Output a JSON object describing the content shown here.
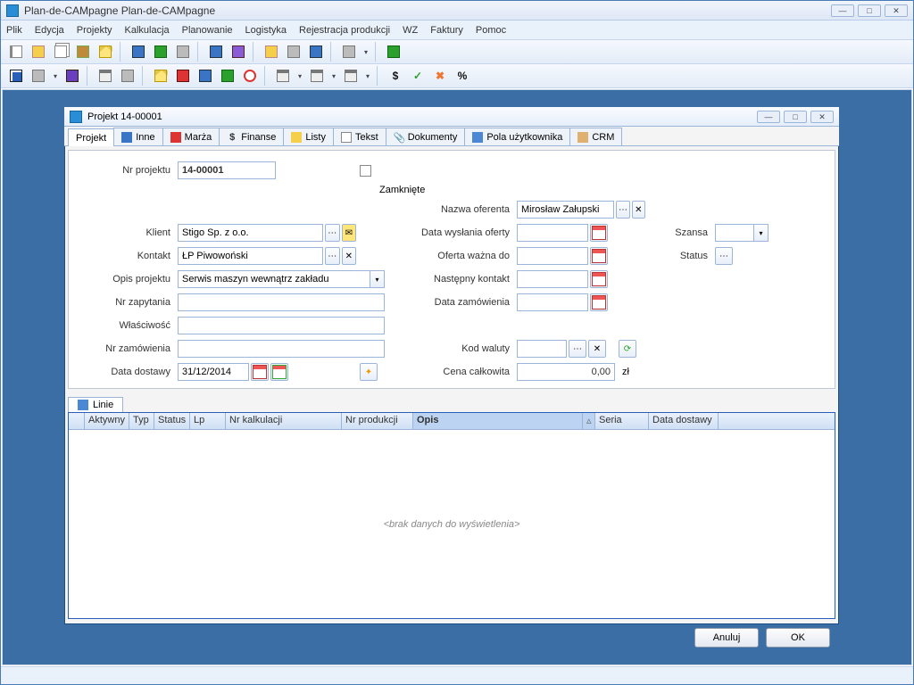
{
  "app": {
    "title": "Plan-de-CAMpagne   Plan-de-CAMpagne"
  },
  "menu": [
    "Plik",
    "Edycja",
    "Projekty",
    "Kalkulacja",
    "Planowanie",
    "Logistyka",
    "Rejestracja produkcji",
    "WZ",
    "Faktury",
    "Pomoc"
  ],
  "inner": {
    "title": "Projekt 14-00001",
    "tabs": [
      "Projekt",
      "Inne",
      "Marża",
      "Finanse",
      "Listy",
      "Tekst",
      "Dokumenty",
      "Pola użytkownika",
      "CRM"
    ],
    "labels": {
      "nr_projektu": "Nr projektu",
      "zamkniete": "Zamknięte",
      "nazwa_oferenta": "Nazwa oferenta",
      "klient": "Klient",
      "data_wyslania": "Data wysłania oferty",
      "szansa": "Szansa",
      "kontakt": "Kontakt",
      "oferta_wazna": "Oferta ważna do",
      "status": "Status",
      "opis_projektu": "Opis projektu",
      "nastepny_kontakt": "Następny kontakt",
      "nr_zapytania": "Nr zapytania",
      "data_zamowienia": "Data zamówienia",
      "wlasciowosc": "Właściwość",
      "nr_zamowienia": "Nr zamówienia",
      "kod_waluty": "Kod waluty",
      "data_dostawy": "Data dostawy",
      "cena_calkowita": "Cena całkowita",
      "zl": "zł"
    },
    "values": {
      "nr_projektu": "14-00001",
      "klient": "Stigo Sp. z o.o.",
      "kontakt": "ŁP Piwowoński",
      "opis_projektu": "Serwis maszyn wewnątrz zakładu",
      "nazwa_oferenta": "Mirosław Załupski",
      "data_dostawy": "31/12/2014",
      "cena_calkowita": "0,00"
    },
    "linie_tab": "Linie",
    "grid_headers": [
      "",
      "Aktywny",
      "Typ",
      "Status",
      "Lp",
      "Nr kalkulacji",
      "Nr produkcji",
      "Opis",
      "",
      "Seria",
      "Data dostawy",
      ""
    ],
    "grid_empty": "<brak danych do wyświetlenia>",
    "buttons": {
      "anuluj": "Anuluj",
      "ok": "OK"
    }
  }
}
